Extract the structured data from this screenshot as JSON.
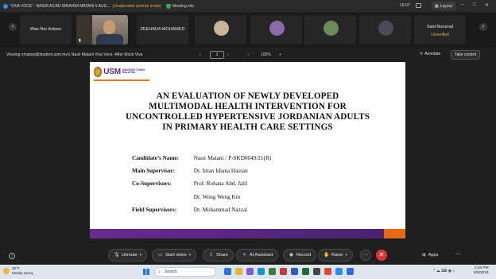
{
  "window": {
    "meeting_title": "'VIVA VOCE' - NASIR AS'AD IBRAHIM MATANI 5 AUG...",
    "unmute_warning": "(Unattended unmute mode)",
    "meeting_info_label": "Meeting info",
    "time": "16:07",
    "layout_label": "Layout",
    "win_controls": [
      "–",
      "□",
      "✕"
    ]
  },
  "participants": [
    {
      "name": "Wan Nor Azleen",
      "type": "name-only"
    },
    {
      "name": "",
      "type": "video"
    },
    {
      "name": "ZEEHADA MOHAMED",
      "type": "name-only-bottom"
    },
    {
      "name": "",
      "type": "avatar",
      "color": "#c8b59a"
    },
    {
      "name": "",
      "type": "avatar",
      "color": "#8a6aa8"
    },
    {
      "name": "",
      "type": "avatar",
      "color": "#6a8a5a"
    },
    {
      "name": "",
      "type": "avatar",
      "color": "#4a4a5a"
    },
    {
      "name": "Said Nurumal",
      "sub": "Unverified",
      "type": "unverified"
    }
  ],
  "share_bar": {
    "viewing": "Viewing nmatani@student.usm.my's Nasir Matani Viva Voce -After Mock Viva",
    "page": "1",
    "zoom": "100%",
    "annotate_label": "Annotate",
    "take_control_label": "Take control"
  },
  "slide": {
    "logo_text": "USM",
    "logo_sub": "UNIVERSITI SAINS MALAYSIA",
    "title_lines": [
      "AN EVALUATION OF NEWLY DEVELOPED",
      "MULTIMODAL HEALTH INTERVENTION FOR",
      "UNCONTROLLED HYPERTENSIVE JORDANIAN ADULTS",
      "IN PRIMARY HEALTH CARE SETTINGS"
    ],
    "rows": [
      {
        "label": "Candidate’s Name:",
        "value": "Nasir Matani / P-SKD0049/21(R)"
      },
      {
        "label": "Main Supervisor:",
        "value": "Dr. Intan Idiana Hassan"
      },
      {
        "label": "Co-Supervisors:",
        "value": "Prof. Rohana Abd. Jalil"
      },
      {
        "label": "",
        "value": "Dr. Wong Weng Kin"
      },
      {
        "label": "Field Supervisors:",
        "value": "Dr. Mohammad Nazzal"
      }
    ]
  },
  "toolbar": {
    "unmute": "Unmute",
    "start_video": "Start video",
    "share": "Share",
    "ai_assistant": "AI Assistant",
    "record": "Record",
    "raise": "Raise",
    "more": "···",
    "end": "✕",
    "apps": "Apps"
  },
  "taskbar": {
    "temp": "30°F",
    "weather": "Mostly sunny",
    "search_placeholder": "Search",
    "time": "2:26 PM",
    "date": "8/5/2025"
  }
}
